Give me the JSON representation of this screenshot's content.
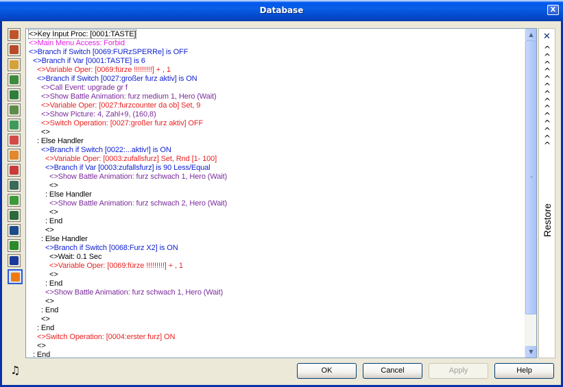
{
  "window": {
    "title": "Database",
    "close_glyph": "X"
  },
  "sidebar": {
    "icons": [
      {
        "name": "hero-icon",
        "color": "#c0532c"
      },
      {
        "name": "class-icon",
        "color": "#b84a2a"
      },
      {
        "name": "skill-icon",
        "color": "#d4a23a"
      },
      {
        "name": "item-icon",
        "color": "#3d8a3d"
      },
      {
        "name": "monster-icon",
        "color": "#2f7d3a"
      },
      {
        "name": "monster-group-icon",
        "color": "#5c8c4a"
      },
      {
        "name": "terrain-icon",
        "color": "#3f9a5a"
      },
      {
        "name": "attribute-icon",
        "color": "#d24a4a"
      },
      {
        "name": "condition-icon",
        "color": "#e0882a"
      },
      {
        "name": "battle-animation-icon",
        "color": "#c93a3a"
      },
      {
        "name": "battle-layout-icon",
        "color": "#3a6a5a"
      },
      {
        "name": "chipset-icon",
        "color": "#3a9a3a"
      },
      {
        "name": "vocabulary-icon",
        "color": "#2a6a3a"
      },
      {
        "name": "system-icon",
        "color": "#1a4a8a"
      },
      {
        "name": "common-event-icon",
        "color": "#2a8a2a"
      },
      {
        "name": "switch-icon",
        "color": "#1a3a9a"
      },
      {
        "name": "variable-cube-icon",
        "color": "#f07a10"
      }
    ],
    "music_icon": "music-note-icon"
  },
  "script": {
    "lines": [
      {
        "indent": 0,
        "color": "black",
        "text": "<>Key Input Proc: [0001:TASTE]"
      },
      {
        "indent": 0,
        "color": "magenta",
        "text": "<>Main Menu Access: Forbid"
      },
      {
        "indent": 0,
        "color": "blue",
        "text": "<>Branch if  Switch [0069:FURzSPERRe] is OFF"
      },
      {
        "indent": 1,
        "color": "blue",
        "text": "<>Branch if Var [0001:TASTE] is 6"
      },
      {
        "indent": 2,
        "color": "red",
        "text": "<>Variable Oper: [0069:fürze !!!!!!!!!] + , 1"
      },
      {
        "indent": 2,
        "color": "blue",
        "text": "<>Branch if  Switch [0027:großer furz aktiv] is ON"
      },
      {
        "indent": 3,
        "color": "purple",
        "text": "<>Call Event: upgrade gr f"
      },
      {
        "indent": 3,
        "color": "purple",
        "text": "<>Show Battle Animation: furz medium 1, Hero (Wait)"
      },
      {
        "indent": 3,
        "color": "red",
        "text": "<>Variable Oper: [0027:furzcounter da ob] Set, 9"
      },
      {
        "indent": 3,
        "color": "purple",
        "text": "<>Show Picture: 4, Zahl+9, (160,8)"
      },
      {
        "indent": 3,
        "color": "red",
        "text": "<>Switch Operation: [0027:großer furz aktiv] OFF"
      },
      {
        "indent": 3,
        "color": "black",
        "text": "<>"
      },
      {
        "indent": 2,
        "color": "black",
        "text": ": Else Handler"
      },
      {
        "indent": 3,
        "color": "blue",
        "text": "<>Branch if  Switch [0022:...aktiv!] is ON"
      },
      {
        "indent": 4,
        "color": "red",
        "text": "<>Variable Oper: [0003:zufallsfurz] Set, Rnd [1- 100]"
      },
      {
        "indent": 4,
        "color": "blue",
        "text": "<>Branch if Var [0003:zufallsfurz] is 90 Less/Equal"
      },
      {
        "indent": 5,
        "color": "purple",
        "text": "<>Show Battle Animation: furz schwach 1, Hero (Wait)"
      },
      {
        "indent": 5,
        "color": "black",
        "text": "<>"
      },
      {
        "indent": 4,
        "color": "black",
        "text": ": Else Handler"
      },
      {
        "indent": 5,
        "color": "purple",
        "text": "<>Show Battle Animation: furz schwach 2, Hero (Wait)"
      },
      {
        "indent": 5,
        "color": "black",
        "text": "<>"
      },
      {
        "indent": 4,
        "color": "black",
        "text": ": End"
      },
      {
        "indent": 4,
        "color": "black",
        "text": "<>"
      },
      {
        "indent": 3,
        "color": "black",
        "text": ": Else Handler"
      },
      {
        "indent": 4,
        "color": "blue",
        "text": "<>Branch if  Switch [0068:Furz X2] is ON"
      },
      {
        "indent": 5,
        "color": "black",
        "text": "<>Wait: 0.1 Sec"
      },
      {
        "indent": 5,
        "color": "red",
        "text": "<>Variable Oper: [0069:fürze !!!!!!!!!] + , 1"
      },
      {
        "indent": 5,
        "color": "black",
        "text": "<>"
      },
      {
        "indent": 4,
        "color": "black",
        "text": ": End"
      },
      {
        "indent": 4,
        "color": "purple",
        "text": "<>Show Battle Animation: furz schwach 1, Hero (Wait)"
      },
      {
        "indent": 4,
        "color": "black",
        "text": "<>"
      },
      {
        "indent": 3,
        "color": "black",
        "text": ": End"
      },
      {
        "indent": 3,
        "color": "black",
        "text": "<>"
      },
      {
        "indent": 2,
        "color": "black",
        "text": ": End"
      },
      {
        "indent": 2,
        "color": "red",
        "text": "<>Switch Operation: [0004:erster furz] ON"
      },
      {
        "indent": 2,
        "color": "black",
        "text": "<>"
      },
      {
        "indent": 1,
        "color": "black",
        "text": ": End"
      }
    ]
  },
  "restore_panel": {
    "collapse_glyph": "✕",
    "chevron_glyph": "^",
    "chevron_count": 14,
    "label": "Restore"
  },
  "buttons": {
    "ok": "OK",
    "cancel": "Cancel",
    "apply": "Apply",
    "help": "Help"
  },
  "colors": {
    "black": "#000000",
    "magenta": "#e020e0",
    "blue": "#1020d0",
    "red": "#ea1f1f",
    "purple": "#7a2a9a"
  }
}
